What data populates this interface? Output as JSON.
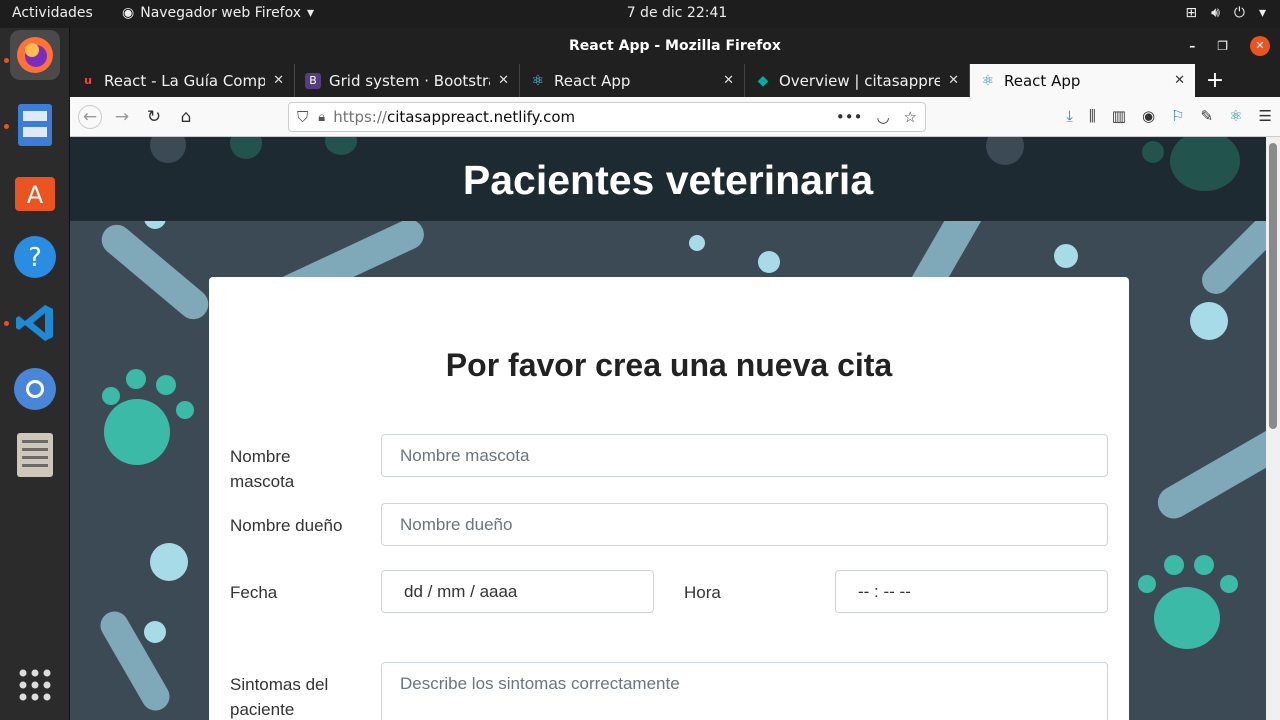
{
  "topbar": {
    "activities": "Actividades",
    "app_menu": "Navegador web Firefox",
    "clock": "7 de dic  22:41"
  },
  "window": {
    "title": "React App - Mozilla Firefox"
  },
  "tabs": [
    {
      "label": "React - La Guía Completa",
      "favicon_color": "#ff3e3e",
      "favicon_glyph": "u"
    },
    {
      "label": "Grid system · Bootstrap",
      "favicon_color": "#563d7c",
      "favicon_glyph": "B"
    },
    {
      "label": "React App",
      "favicon_color": "#61dafb",
      "favicon_glyph": "⚛"
    },
    {
      "label": "Overview | citasappreact",
      "favicon_color": "#00ad9f",
      "favicon_glyph": "◆"
    },
    {
      "label": "React App",
      "favicon_color": "#61dafb",
      "favicon_glyph": "⚛",
      "active": true
    }
  ],
  "url": {
    "protocol": "https://",
    "host": "citasappreact.netlify.com"
  },
  "page": {
    "header_title": "Pacientes veterinaria",
    "form_title": "Por favor crea una nueva cita",
    "fields": {
      "pet_name": {
        "label": "Nombre mascota",
        "placeholder": "Nombre mascota"
      },
      "owner_name": {
        "label": "Nombre dueño",
        "placeholder": "Nombre dueño"
      },
      "date": {
        "label": "Fecha",
        "placeholder": "dd / mm / aaaa"
      },
      "time": {
        "label": "Hora",
        "placeholder": "-- : --   --"
      },
      "symptoms": {
        "label": "Sintomas del paciente",
        "placeholder": "Describe los sintomas correctamente"
      }
    }
  },
  "colors": {
    "hero_bg": "#1e2a31",
    "page_bg": "#3c4a55",
    "accent_paw": "#3cbaa8",
    "bone": "#7fa8b8"
  }
}
